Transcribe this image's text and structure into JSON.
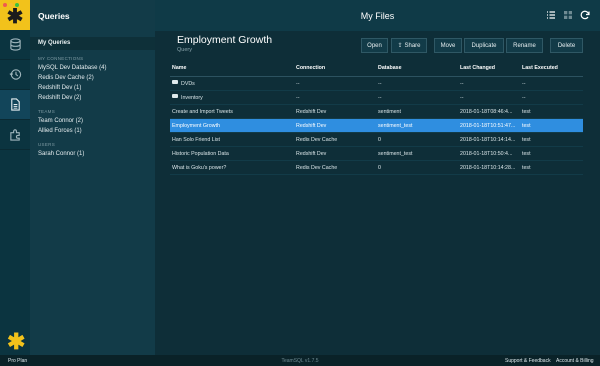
{
  "sidebar": {
    "title": "Queries",
    "selected_item": "My Queries",
    "connections_label": "MY CONNECTIONS",
    "connections": [
      "MySQL Dev Database (4)",
      "Redis Dev Cache (2)",
      "Redshift Dev (1)",
      "Redshift Dev (2)"
    ],
    "teams_label": "TEAMS",
    "teams": [
      "Team Connor (2)",
      "Allied Forces (1)"
    ],
    "users_label": "USERS",
    "users": [
      "Sarah Connor (1)"
    ]
  },
  "header": {
    "title": "My Files"
  },
  "detail": {
    "title": "Employment Growth",
    "subtitle": "Query",
    "buttons": {
      "open": "Open",
      "share": "Share",
      "move": "Move",
      "duplicate": "Duplicate",
      "rename": "Rename",
      "delete": "Delete"
    }
  },
  "table": {
    "columns": [
      "Name",
      "Connection",
      "Database",
      "Last Changed",
      "Last Executed"
    ],
    "rows": [
      {
        "name": "DVDs",
        "folder": true,
        "connection": "--",
        "database": "--",
        "changed": "--",
        "executed": "--"
      },
      {
        "name": "Inventory",
        "folder": true,
        "connection": "--",
        "database": "--",
        "changed": "--",
        "executed": "--"
      },
      {
        "name": "Create and Import Tweets",
        "folder": false,
        "connection": "Redshift Dev",
        "database": "sentiment",
        "changed": "2018-01-18T08:46:4...",
        "executed": "test"
      },
      {
        "name": "Employment Growth",
        "folder": false,
        "connection": "Redshift Dev",
        "database": "sentiment_test",
        "changed": "2018-01-18T10:51:47...",
        "executed": "test"
      },
      {
        "name": "Han Solo Friend List",
        "folder": false,
        "connection": "Redis Dev Cache",
        "database": "0",
        "changed": "2018-01-18T10:14:14...",
        "executed": "test"
      },
      {
        "name": "Historic Population Data",
        "folder": false,
        "connection": "Redshift Dev",
        "database": "sentiment_test",
        "changed": "2018-01-18T10:50:4...",
        "executed": "test"
      },
      {
        "name": "What is Goku's power?",
        "folder": false,
        "connection": "Redis Dev Cache",
        "database": "0",
        "changed": "2018-01-18T10:14:28...",
        "executed": "test"
      }
    ],
    "selected_row": 3
  },
  "statusbar": {
    "plan": "Pro Plan",
    "version": "TeamSQL v1.7.5",
    "support": "Support & Feedback",
    "account": "Account & Billing"
  },
  "colors": {
    "brand": "#f2c21b",
    "selection": "#2f8ee0",
    "background": "#0e2e38",
    "sidebar": "#123b48"
  }
}
